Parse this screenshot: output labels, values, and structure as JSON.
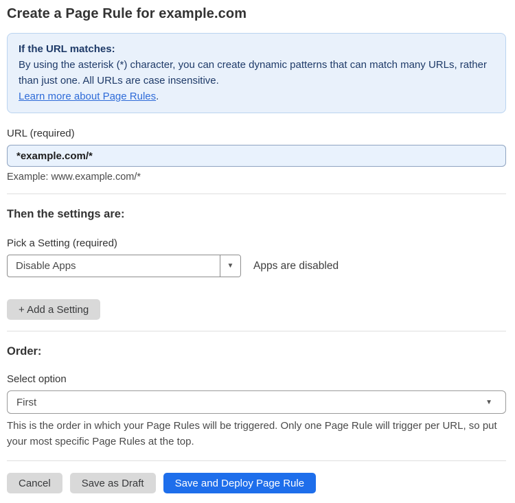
{
  "page": {
    "title": "Create a Page Rule for example.com"
  },
  "info_box": {
    "heading": "If the URL matches:",
    "body": "By using the asterisk (*) character, you can create dynamic patterns that can match many URLs, rather than just one. All URLs are case insensitive.",
    "link_label": "Learn more about Page Rules",
    "link_suffix": "."
  },
  "url_field": {
    "label": "URL (required)",
    "value": "*example.com/*",
    "hint": "Example: www.example.com/*"
  },
  "settings_section": {
    "heading": "Then the settings are:",
    "setting_label": "Pick a Setting (required)",
    "setting_value": "Disable Apps",
    "dropdown_arrow": "▼",
    "setting_status": "Apps are disabled",
    "add_setting_label": "+ Add a Setting"
  },
  "order_section": {
    "heading": "Order:",
    "select_label": "Select option",
    "select_value": "First",
    "dropdown_arrow": "▼",
    "help_text": "This is the order in which your Page Rules will be triggered. Only one Page Rule will trigger per URL, so put your most specific Page Rules at the top."
  },
  "footer": {
    "cancel_label": "Cancel",
    "save_draft_label": "Save as Draft",
    "save_deploy_label": "Save and Deploy Page Rule"
  },
  "colors": {
    "primary_blue": "#1e6eeb",
    "info_background": "#e9f1fb",
    "info_border": "#bad3f0",
    "info_text": "#1e3a68",
    "link_blue": "#2e6bd8",
    "input_background": "#e9f2fd",
    "button_gray": "#d9d9d9"
  }
}
